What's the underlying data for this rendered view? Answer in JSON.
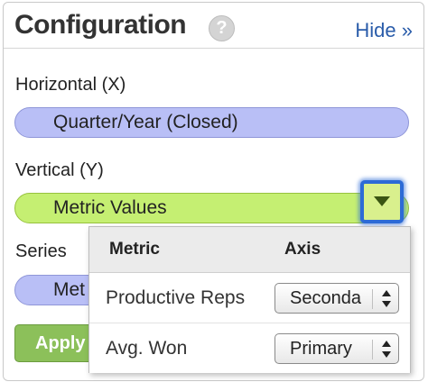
{
  "header": {
    "title": "Configuration",
    "help_icon": "?",
    "hide_link": "Hide »"
  },
  "horizontal": {
    "label": "Horizontal (X)",
    "value": "Quarter/Year (Closed)"
  },
  "vertical": {
    "label": "Vertical (Y)",
    "value": "Metric Values"
  },
  "series": {
    "label": "Series",
    "value": "Met"
  },
  "apply_button": "Apply",
  "popup": {
    "col_metric": "Metric",
    "col_axis": "Axis",
    "rows": [
      {
        "metric": "Productive Reps",
        "axis": "Seconda"
      },
      {
        "metric": "Avg. Won",
        "axis": "Primary"
      }
    ]
  },
  "colors": {
    "pill_blue": "#b9bff6",
    "pill_green": "#c5ef72",
    "link_blue": "#2a5caa",
    "focus_ring": "#2d6bd6",
    "apply_green": "#8cc05a"
  }
}
